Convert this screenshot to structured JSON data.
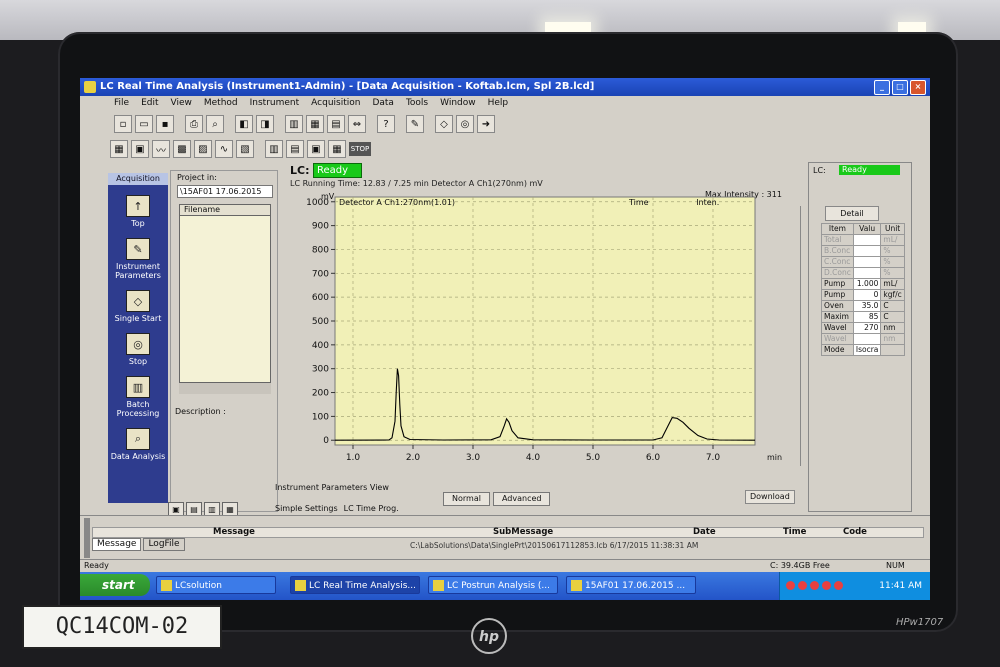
{
  "window": {
    "title": "LC Real Time Analysis (Instrument1-Admin) - [Data Acquisition - Koftab.lcm, Spl 2B.lcd]",
    "menu": [
      "File",
      "Edit",
      "View",
      "Method",
      "Instrument",
      "Acquisition",
      "Data",
      "Tools",
      "Window",
      "Help"
    ]
  },
  "sidebar": {
    "header": "Acquisition",
    "items": [
      {
        "label": "Top",
        "icon": "arrow-up-icon"
      },
      {
        "label": "Instrument Parameters",
        "icon": "instrument-icon"
      },
      {
        "label": "Single Start",
        "icon": "single-start-icon"
      },
      {
        "label": "Stop",
        "icon": "stop-icon"
      },
      {
        "label": "Batch Processing",
        "icon": "batch-icon"
      },
      {
        "label": "Data Analysis",
        "icon": "analysis-icon"
      }
    ]
  },
  "project": {
    "label": "Project in:",
    "selected": "\\15AF01 17.06.2015",
    "file_header": "Filename",
    "description": "Description :"
  },
  "acquisition": {
    "lc_label": "LC:",
    "status": "Ready",
    "running_time": "LC Running Time: 12.83 / 7.25 min Detector A Ch1(270nm) mV",
    "max_intensity": "Max Intensity : 311",
    "stop_button": "STOP",
    "instrument_view": "Instrument Parameters View",
    "tabs": [
      "Normal",
      "Advanced"
    ],
    "bottom_tabs": [
      "Simple Settings",
      "LC Time Prog."
    ],
    "download": "Download"
  },
  "chart_data": {
    "type": "line",
    "title": "",
    "series": [
      {
        "name": "Detector A Ch1:270nm(1.01)",
        "x": [
          0.7,
          1.6,
          1.65,
          1.7,
          1.72,
          1.74,
          1.76,
          1.78,
          1.8,
          1.85,
          1.95,
          2.5,
          3.3,
          3.45,
          3.52,
          3.56,
          3.6,
          3.65,
          3.75,
          4.0,
          5.0,
          6.0,
          6.15,
          6.25,
          6.32,
          6.4,
          6.5,
          6.6,
          6.75,
          6.9,
          7.1,
          7.7
        ],
        "y": [
          0,
          1,
          10,
          80,
          200,
          300,
          270,
          150,
          60,
          15,
          3,
          1,
          2,
          15,
          60,
          90,
          75,
          40,
          10,
          2,
          1,
          1,
          10,
          60,
          95,
          92,
          75,
          50,
          20,
          5,
          1,
          0
        ]
      }
    ],
    "xlabel": "min",
    "ylabel": "mV",
    "legend_time": "Time",
    "legend_inten": "Inten.",
    "xlim": [
      0.7,
      7.7
    ],
    "ylim": [
      -20,
      1020
    ],
    "xticks": [
      1.0,
      2.0,
      3.0,
      4.0,
      5.0,
      6.0,
      7.0
    ],
    "yticks": [
      0,
      100,
      200,
      300,
      400,
      500,
      600,
      700,
      800,
      900,
      1000
    ],
    "xtick_labels": [
      "1.0",
      "2.0",
      "3.0",
      "4.0",
      "5.0",
      "6.0",
      "7.0"
    ],
    "ytick_labels": [
      "0",
      "100",
      "200",
      "300",
      "400",
      "500",
      "600",
      "700",
      "800",
      "900",
      "1000"
    ],
    "grid": true,
    "colors": {
      "background": "#f1f0b7",
      "line": "#000000",
      "grid": "#a8a878"
    }
  },
  "status_panel": {
    "lc_label": "LC:",
    "status": "Ready",
    "detail_button": "Detail",
    "columns": [
      "Item",
      "Valu",
      "Unit"
    ],
    "rows": [
      {
        "item": "Total",
        "value": "",
        "unit": "mL/",
        "dim": true
      },
      {
        "item": "B.Conc",
        "value": "",
        "unit": "%",
        "dim": true
      },
      {
        "item": "C.Conc",
        "value": "",
        "unit": "%",
        "dim": true
      },
      {
        "item": "D.Conc",
        "value": "",
        "unit": "%",
        "dim": true
      },
      {
        "item": "Pump",
        "value": "1.000",
        "unit": "mL/",
        "dim": false
      },
      {
        "item": "Pump",
        "value": "0",
        "unit": "kgf/c",
        "dim": false
      },
      {
        "item": "Oven",
        "value": "35.0",
        "unit": "C",
        "dim": false
      },
      {
        "item": "Maxim",
        "value": "85",
        "unit": "C",
        "dim": false
      },
      {
        "item": "Wavel",
        "value": "270",
        "unit": "nm",
        "dim": false
      },
      {
        "item": "Wavel",
        "value": "",
        "unit": "nm",
        "dim": true
      },
      {
        "item": "Mode",
        "value": "Isocra",
        "unit": "",
        "dim": false
      }
    ]
  },
  "messages": {
    "headers": [
      "Message",
      "SubMessage",
      "Date",
      "Time",
      "Code"
    ],
    "row": "C:\\LabSolutions\\Data\\SinglePrt\\20150617112853.lcb    6/17/2015    11:38:31 AM",
    "tabs": [
      "Message",
      "LogFile"
    ],
    "status_left": "Ready",
    "status_disk": "C: 39.4GB Free",
    "status_num": "NUM"
  },
  "taskbar": {
    "start": "start",
    "items": [
      "LCsolution",
      "LC Real Time Analysis...",
      "LC Postrun Analysis (...",
      "15AF01 17.06.2015 ..."
    ],
    "clock": "11:41 AM"
  },
  "hardware": {
    "sticker": "QC14COM-02",
    "brand": "hp",
    "model": "HPw1707"
  }
}
